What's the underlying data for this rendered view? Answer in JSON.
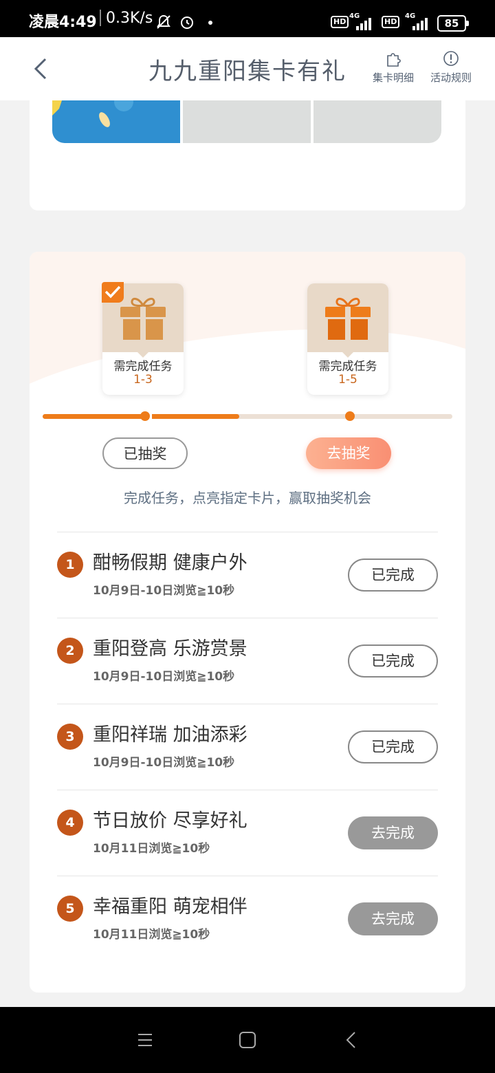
{
  "status_bar": {
    "time": "凌晨4:49",
    "speed": "0.3K/s",
    "hd1": "HD",
    "net1": "4G",
    "hd2": "HD",
    "net2": "4G",
    "battery": "85"
  },
  "header": {
    "title": "九九重阳集卡有礼",
    "card_detail_label": "集卡明细",
    "rules_label": "活动规则"
  },
  "rewards": [
    {
      "need_label": "需完成任务",
      "range": "1-3",
      "claimed": true
    },
    {
      "need_label": "需完成任务",
      "range": "1-5",
      "claimed": false
    }
  ],
  "progress": {
    "completed_fraction": 0.48
  },
  "draw_buttons": {
    "drawn_label": "已抽奖",
    "go_draw_label": "去抽奖"
  },
  "hint": "完成任务，点亮指定卡片，赢取抽奖机会",
  "tasks": [
    {
      "num": "1",
      "title": "酣畅假期 健康户外",
      "subtitle": "10月9日-10日浏览≧10秒",
      "button": "已完成",
      "status": "finished"
    },
    {
      "num": "2",
      "title": "重阳登高 乐游赏景",
      "subtitle": "10月9日-10日浏览≧10秒",
      "button": "已完成",
      "status": "finished"
    },
    {
      "num": "3",
      "title": "重阳祥瑞 加油添彩",
      "subtitle": "10月9日-10日浏览≧10秒",
      "button": "已完成",
      "status": "finished"
    },
    {
      "num": "4",
      "title": "节日放价 尽享好礼",
      "subtitle": "10月11日浏览≧10秒",
      "button": "去完成",
      "status": "todo"
    },
    {
      "num": "5",
      "title": "幸福重阳 萌宠相伴",
      "subtitle": "10月11日浏览≧10秒",
      "button": "去完成",
      "status": "todo"
    }
  ],
  "colors": {
    "accent": "#ee7c1a",
    "number_badge": "#c4561a",
    "go_draw": "#f98f73"
  }
}
